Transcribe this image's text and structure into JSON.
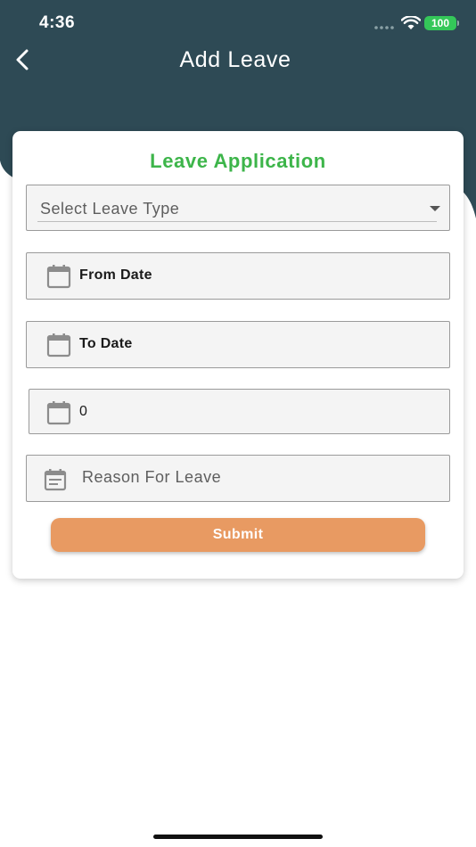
{
  "status_bar": {
    "time": "4:36",
    "battery": "100"
  },
  "header": {
    "title": "Add Leave",
    "background_color": "#2e4a55",
    "back_icon": "chevron-left-icon"
  },
  "form": {
    "title": "Leave Application",
    "title_color": "#3db54a",
    "leave_type": {
      "placeholder": "Select Leave Type",
      "icon": "caret-down-icon"
    },
    "from_date": {
      "label": "From Date",
      "icon": "calendar-icon"
    },
    "to_date": {
      "label": "To Date",
      "icon": "calendar-icon"
    },
    "days": {
      "value": "0",
      "icon": "calendar-icon"
    },
    "reason": {
      "placeholder": "Reason For Leave",
      "icon": "notes-icon"
    },
    "submit": {
      "label": "Submit",
      "color": "#e89a62"
    }
  }
}
